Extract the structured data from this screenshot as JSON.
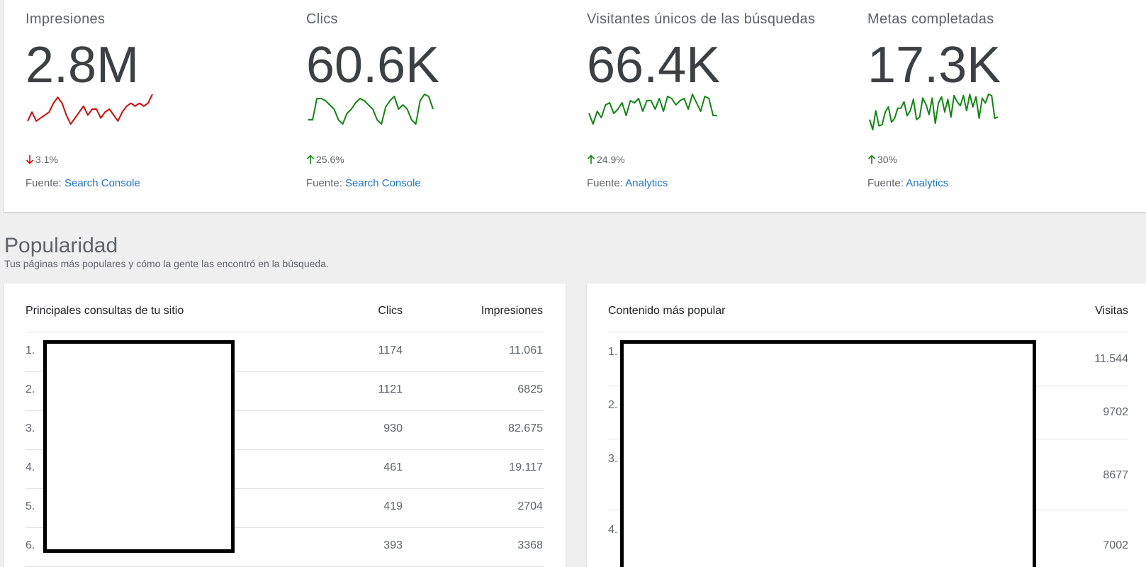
{
  "metrics": [
    {
      "title": "Impresiones",
      "value": "2.8M",
      "change": "3.1%",
      "direction": "down",
      "color": "#e00000",
      "source_prefix": "Fuente:",
      "source": "Search Console",
      "trend": [
        10,
        13,
        10,
        11,
        12,
        13,
        16,
        18,
        16,
        12,
        9,
        11,
        13,
        15,
        12,
        14,
        14,
        11,
        13,
        14,
        12,
        10,
        13,
        15,
        16,
        15,
        16,
        15,
        16,
        19
      ]
    },
    {
      "title": "Clics",
      "value": "60.6K",
      "change": "25.6%",
      "direction": "up",
      "color": "#0a8a0a",
      "source_prefix": "Fuente:",
      "source": "Search Console",
      "trend": [
        3,
        3,
        13,
        13,
        12,
        10,
        8,
        3,
        1,
        6,
        8,
        11,
        13,
        12,
        10,
        8,
        3,
        1,
        9,
        12,
        14,
        8,
        10,
        8,
        3,
        1,
        12,
        15,
        14,
        8
      ]
    },
    {
      "title": "Visitantes únicos de las búsquedas",
      "value": "66.4K",
      "change": "24.9%",
      "direction": "up",
      "color": "#0a8a0a",
      "source_prefix": "Fuente:",
      "source": "Analytics",
      "trend": [
        5,
        0,
        6,
        3,
        9,
        10,
        5,
        7,
        10,
        4,
        11,
        10,
        12,
        6,
        11,
        11,
        7,
        12,
        6,
        13,
        12,
        9,
        11,
        12,
        7,
        14,
        10,
        6,
        13,
        12,
        4,
        4
      ]
    },
    {
      "title": "Metas completadas",
      "value": "17.3K",
      "change": "30%",
      "direction": "up",
      "color": "#0a8a0a",
      "source_prefix": "Fuente:",
      "source": "Analytics",
      "trend": [
        8,
        0,
        15,
        3,
        4,
        14,
        18,
        6,
        9,
        17,
        17,
        22,
        11,
        15,
        24,
        8,
        10,
        25,
        20,
        12,
        25,
        5,
        21,
        26,
        14,
        24,
        10,
        27,
        22,
        19,
        27,
        15,
        28,
        18,
        26,
        9,
        25,
        21,
        28,
        27,
        9,
        10
      ]
    }
  ],
  "popularity": {
    "title": "Popularidad",
    "subtitle": "Tus páginas más populares y cómo la gente las encontró en la búsqueda."
  },
  "queries_table": {
    "headers": {
      "query": "Principales consultas de tu sitio",
      "clicks": "Clics",
      "impressions": "Impresiones"
    },
    "rows": [
      {
        "index": "1.",
        "clicks": "1174",
        "impressions": "11.061"
      },
      {
        "index": "2.",
        "clicks": "1121",
        "impressions": "6825"
      },
      {
        "index": "3.",
        "clicks": "930",
        "impressions": "82.675"
      },
      {
        "index": "4.",
        "clicks": "461",
        "impressions": "19.117"
      },
      {
        "index": "5.",
        "clicks": "419",
        "impressions": "2704"
      },
      {
        "index": "6.",
        "clicks": "393",
        "impressions": "3368"
      }
    ]
  },
  "content_table": {
    "headers": {
      "content": "Contenido más popular",
      "visits": "Visitas"
    },
    "rows": [
      {
        "index": "1.",
        "visits": "11.544"
      },
      {
        "index": "2.",
        "visits": "9702"
      },
      {
        "index": "3.",
        "visits": "8677"
      },
      {
        "index": "4.",
        "visits": "7002"
      }
    ]
  }
}
